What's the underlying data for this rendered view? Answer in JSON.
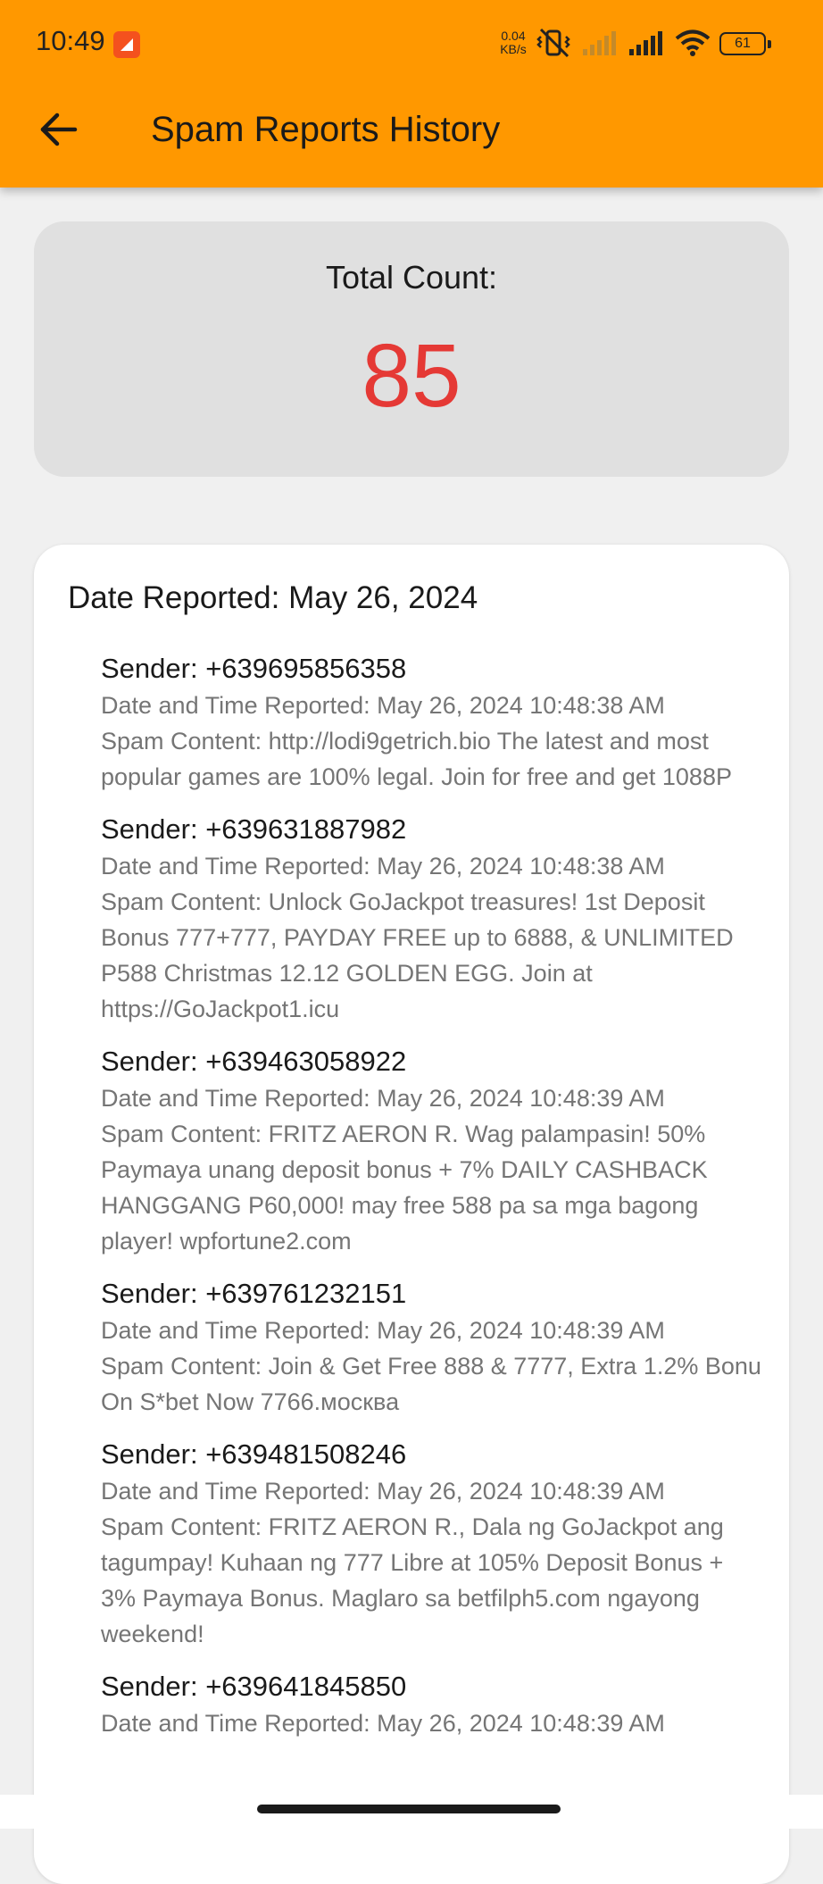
{
  "status_bar": {
    "time": "10:49",
    "net_speed_value": "0.04",
    "net_speed_unit": "KB/s",
    "battery": "61",
    "icons": [
      "notification-app-icon",
      "mute-vibrate-icon",
      "signal-icon",
      "signal-icon",
      "wifi-icon",
      "battery-icon"
    ]
  },
  "app_bar": {
    "back_icon": "arrow-left-icon",
    "title": "Spam Reports History",
    "color": "#ff9800"
  },
  "summary": {
    "label": "Total Count:",
    "value": "85",
    "value_color": "#e53935"
  },
  "group": {
    "date_header": "Date Reported: May 26, 2024",
    "reports": [
      {
        "sender": "Sender: +639695856358",
        "reported": "Date and Time Reported: May 26, 2024 10:48:38  AM",
        "content": "Spam Content: http://lodi9getrich.bio  The latest and most popular games are 100% legal. Join for free and get 1088P"
      },
      {
        "sender": "Sender: +639631887982",
        "reported": "Date and Time Reported: May 26, 2024 10:48:38  AM",
        "content": "Spam Content: Unlock GoJackpot treasures! 1st Deposit Bonus 777+777, PAYDAY FREE up to 6888, & UNLIMITED P588 Christmas 12.12 GOLDEN EGG. Join at https://GoJackpot1.icu"
      },
      {
        "sender": "Sender: +639463058922",
        "reported": "Date and Time Reported: May 26, 2024 10:48:39  AM",
        "content": "Spam Content: FRITZ AERON R. Wag palampasin! 50% Paymaya unang deposit bonus + 7% DAILY CASHBACK HANGGANG P60,000! may free 588 pa sa mga bagong player!  wpfortune2.com"
      },
      {
        "sender": "Sender: +639761232151",
        "reported": "Date and Time Reported: May 26, 2024 10:48:39  AM",
        "content": "Spam Content: Join & Get Free 888 & 7777, Extra 1.2% Bonu On S*bet Now 7766.москва"
      },
      {
        "sender": "Sender: +639481508246",
        "reported": "Date and Time Reported: May 26, 2024 10:48:39  AM",
        "content": "Spam Content: FRITZ AERON R., Dala ng GoJackpot ang tagumpay! Kuhaan ng 777 Libre at 105% Deposit Bonus + 3% Paymaya Bonus. Maglaro sa betfilph5.com ngayong weekend!"
      },
      {
        "sender": "Sender: +639641845850",
        "reported": "Date and Time Reported: May 26, 2024 10:48:39  AM",
        "content": ""
      }
    ]
  }
}
